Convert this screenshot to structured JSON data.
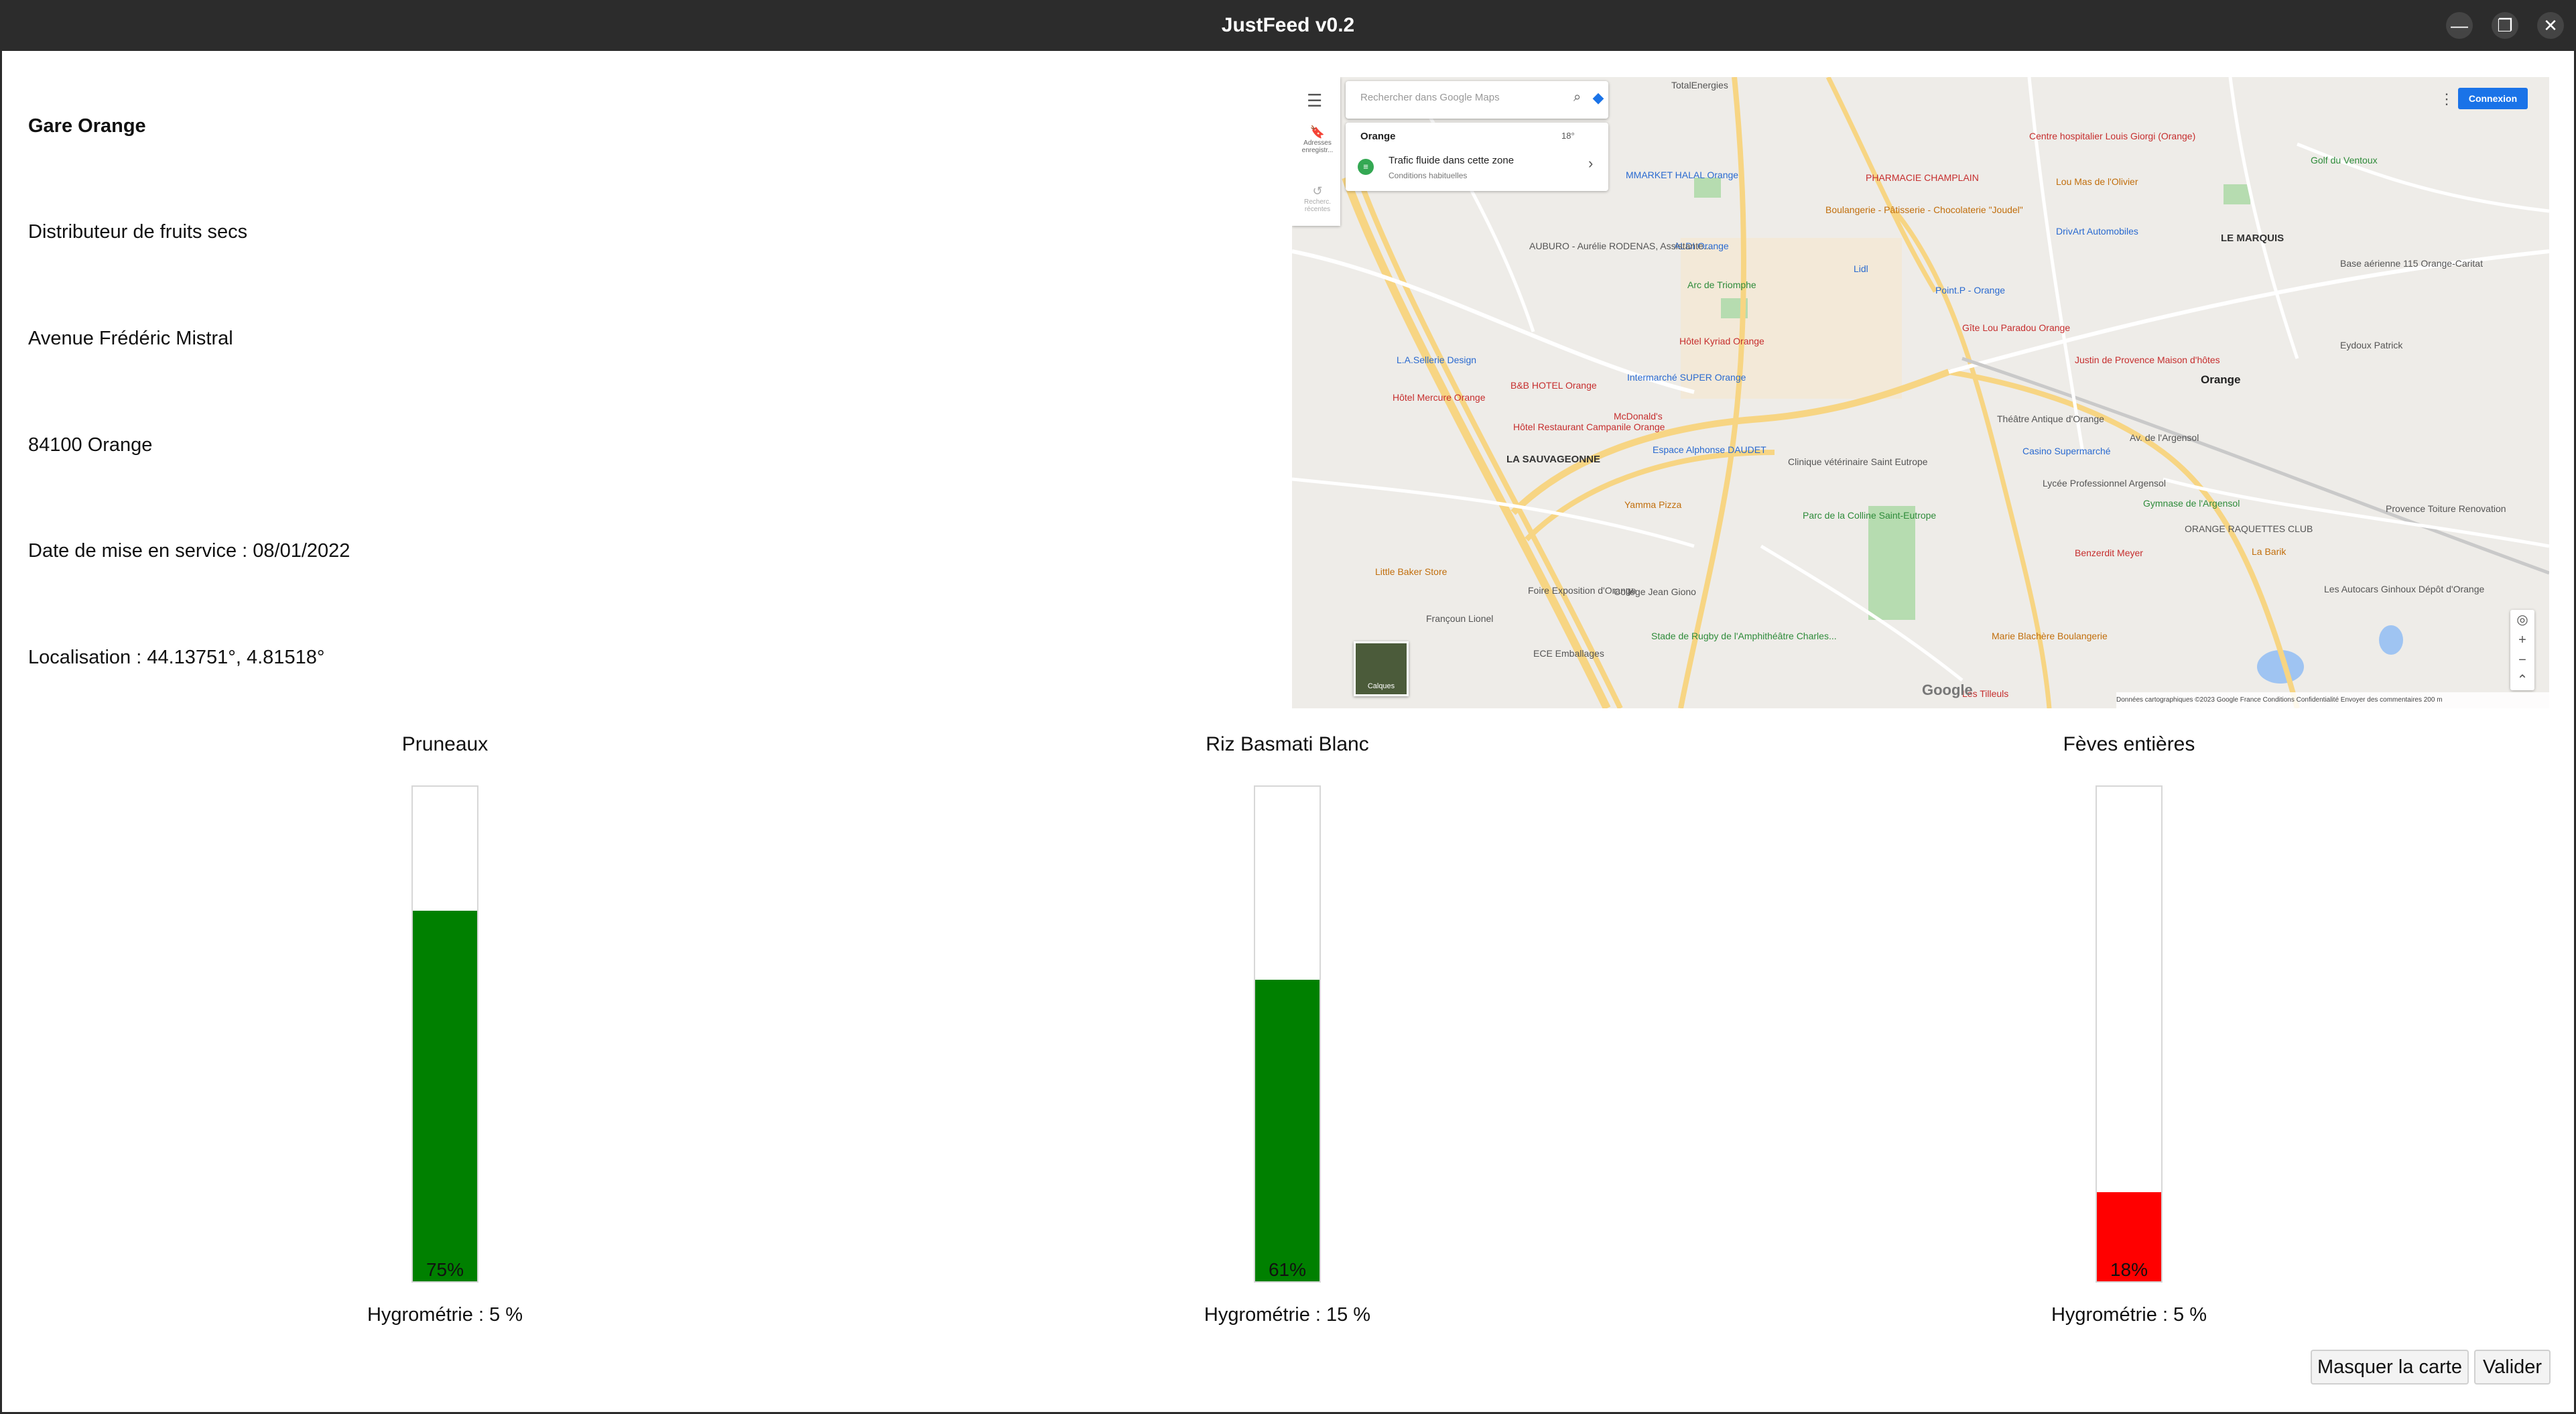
{
  "window": {
    "title": "JustFeed v0.2",
    "controls": [
      "—",
      "❐",
      "✕"
    ]
  },
  "station": {
    "name": "Gare Orange",
    "type": "Distributeur de fruits secs",
    "street": "Avenue Frédéric Mistral",
    "city": "84100 Orange",
    "service_date": "Date de mise en service : 08/01/2022",
    "location": "Localisation : 44.13751°, 4.81518°"
  },
  "map": {
    "search_placeholder": "Rechercher dans Google Maps",
    "sidebar_saved": "Adresses enregistr...",
    "sidebar_history": "Recherc. récentes",
    "area_name": "Orange",
    "temperature": "18°",
    "traffic_text": "Trafic fluide dans cette zone",
    "traffic_sub": "Conditions habituelles",
    "connexion_label": "Connexion",
    "layers_label": "Calques",
    "google_logo": "Google",
    "footer": "Données cartographiques ©2023 Google   France   Conditions   Confidentialité   Envoyer des commentaires   200 m",
    "labels": {
      "orange": "Orange",
      "le_marquis": "LE MARQUIS",
      "la_sauvageonne": "LA SAUVAGEONNE",
      "arc": "Arc de Triomphe",
      "theatre": "Théâtre Antique d'Orange",
      "centre_hosp": "Centre hospitalier Louis Giorgi (Orange)",
      "pharmacie": "PHARMACIE CHAMPLAIN",
      "boulangerie": "Boulangerie - Pâtisserie - Chocolaterie \"Joudel\"",
      "aldi": "ALDI Orange",
      "lidl": "Lidl",
      "mcdonalds": "McDonald's",
      "hotel_kyriad": "Hôtel Kyriad Orange",
      "bb_hotel": "B&B HOTEL Orange",
      "hotel_mercure": "Hôtel Mercure Orange",
      "campanile": "Hôtel Restaurant Campanile Orange",
      "intermarche": "Intermarché SUPER Orange",
      "casino": "Casino Supermarché",
      "parc_colline": "Parc de la Colline Saint-Eutrope",
      "yamma": "Yamma Pizza",
      "college": "Collège Jean Giono",
      "stade": "Stade de Rugby de l'Amphithéâtre Charles...",
      "little_baker": "Little Baker Store",
      "foire": "Foire Exposition d'Orange",
      "francoun": "Françoun Lionel",
      "ece": "ECE Emballages",
      "les_tilleuls": "Les Tilleuls",
      "marie_blachere": "Marie Blachère Boulangerie",
      "benzerdit": "Benzerdit Meyer",
      "la_barik": "La Barik",
      "gymnase": "Gymnase de l'Argensol",
      "lycee": "Lycée Professionnel Argensol",
      "golf": "Golf du Ventoux",
      "base_aerienne": "Base aérienne 115 Orange-Caritat",
      "eydoux": "Eydoux Patrick",
      "justin": "Justin de Provence Maison d'hôtes",
      "gite": "Gîte Lou Paradou Orange",
      "point_p": "Point.P - Orange",
      "drivart": "DrivArt Automobiles",
      "lou_mas": "Lou Mas de l'Olivier",
      "totalenergies": "TotalEnergies",
      "mmarket": "MMARKET HALAL Orange",
      "auburo": "AUBURO - Aurélie RODENAS, Assistante...",
      "la_sellerie": "L.A.Sellerie Design",
      "provence_toiture": "Provence Toiture Renovation",
      "les_autocars": "Les Autocars Ginhoux Dépôt d'Orange",
      "orange_raquettes": "ORANGE RAQUETTES CLUB",
      "espace_alphonse": "Espace Alphonse DAUDET",
      "clinique_st_eutrope": "Clinique vétérinaire Saint Eutrope",
      "av_argensol": "Av. de l'Argensol"
    }
  },
  "products": [
    {
      "name": "Pruneaux",
      "level": 0.75,
      "level_label": "75%",
      "color": "#008000",
      "hygrometry": "Hygrométrie : 5 %"
    },
    {
      "name": "Riz Basmati Blanc",
      "level": 0.61,
      "level_label": "61%",
      "color": "#008000",
      "hygrometry": "Hygrométrie : 15 %"
    },
    {
      "name": "Fèves entières",
      "level": 0.18,
      "level_label": "18%",
      "color": "#ff0000",
      "hygrometry": "Hygrométrie : 5 %"
    }
  ],
  "actions": {
    "hide_map": "Masquer la carte",
    "validate": "Valider"
  }
}
